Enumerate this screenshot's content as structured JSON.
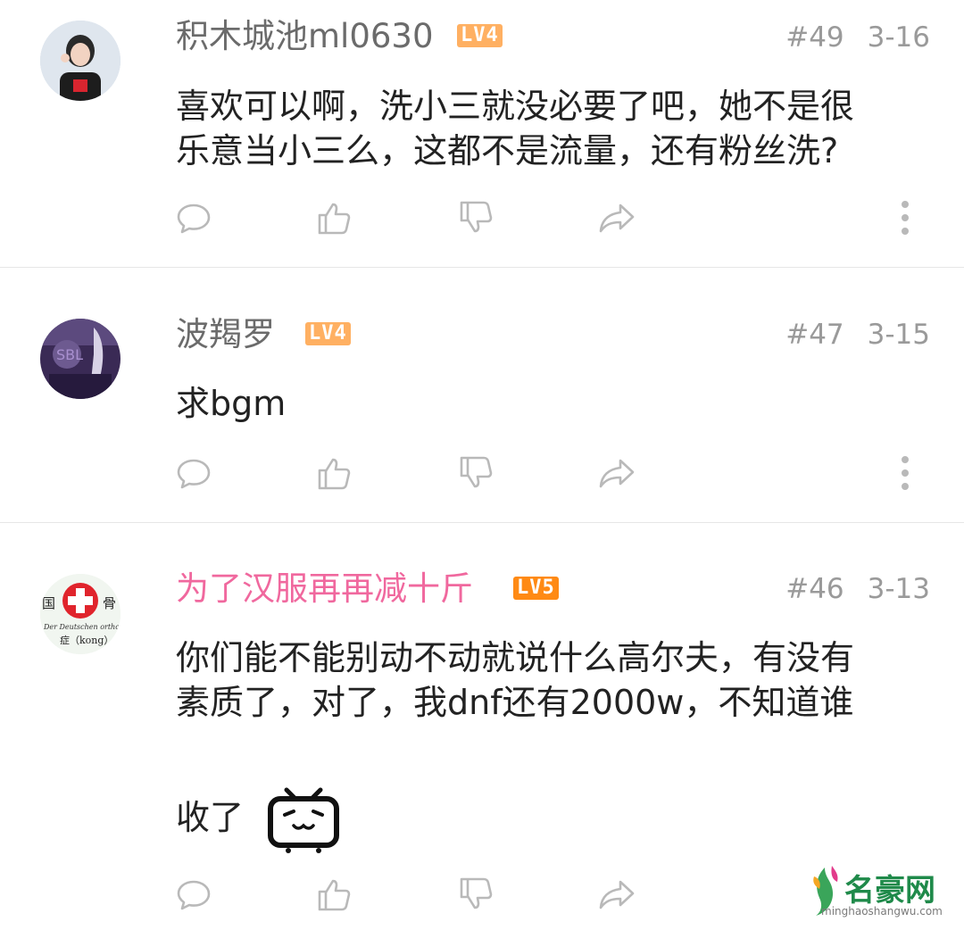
{
  "comments": [
    {
      "username": "积木城池ml0630",
      "level": "LV4",
      "floor": "#49",
      "date": "3-16",
      "text_lines": [
        "喜欢可以啊，洗小三就没必要了吧，她不是很",
        "乐意当小三么，这都不是流量，还有粉丝洗?"
      ],
      "avatar_icon": "avatar-photo-girl"
    },
    {
      "username": "波羯罗",
      "level": "LV4",
      "floor": "#47",
      "date": "3-15",
      "text_lines": [
        "求bgm"
      ],
      "avatar_icon": "avatar-purple-art"
    },
    {
      "username": "为了汉服再再减十斤",
      "level": "LV5",
      "floor": "#46",
      "date": "3-13",
      "text_lines": [
        "你们能不能别动不动就说什么高尔夫，有没有",
        "素质了，对了，我dnf还有2000w，不知道谁",
        "",
        "收了"
      ],
      "avatar_icon": "avatar-red-cross-hospital",
      "avatar_text": {
        "left": "国",
        "right": "骨",
        "sub": "Der Deutschen orthopädie",
        "bottom": "症（kong）"
      },
      "emoji_icon": "bilibili-tv-emoticon"
    }
  ],
  "actions": [
    "reply-icon",
    "like-icon",
    "dislike-icon",
    "share-icon",
    "more-icon"
  ],
  "watermark": {
    "name": "名豪网",
    "url": "minghaoshangwu.com"
  },
  "colors": {
    "vip_name": "#f0689e",
    "lv4": "#ffb062",
    "lv5": "#ff8a14",
    "icon": "#b9b9b9",
    "meta": "#9a9a9a"
  }
}
